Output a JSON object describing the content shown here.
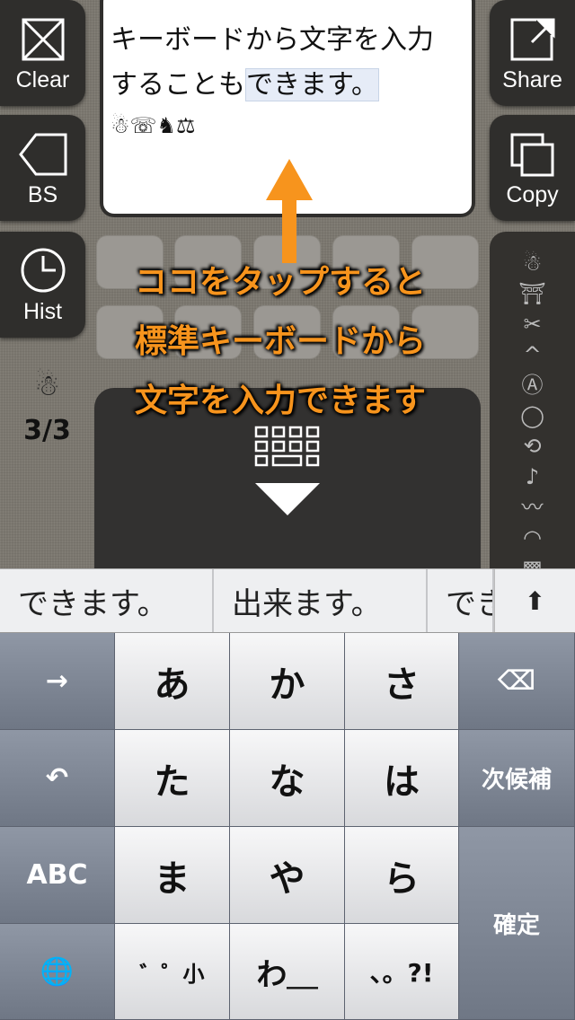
{
  "left_buttons": [
    {
      "label": "Clear",
      "icon": "x-box-icon"
    },
    {
      "label": "BS",
      "icon": "backspace-icon"
    },
    {
      "label": "Hist",
      "icon": "clock-icon"
    }
  ],
  "right_buttons": [
    {
      "label": "Share",
      "icon": "share-icon"
    },
    {
      "label": "Copy",
      "icon": "copy-icon"
    }
  ],
  "textbox": {
    "line1": "キーボードから文字を入力",
    "line2_plain": "することも",
    "line2_marked": "できます。",
    "emoji_line": "☃☏♞⚖"
  },
  "history": {
    "icon": "☃",
    "count": "3/3"
  },
  "overlay": {
    "lines": [
      "ココをタップすると",
      "標準キーボードから",
      "文字を入力できます"
    ],
    "color": "#f7941d"
  },
  "right_panel": {
    "symbols": [
      "☃",
      "⛩",
      "✂",
      "^",
      "Ⓐ",
      "◯",
      "⟲",
      "♪",
      "〰",
      "◠",
      "▩",
      "◓"
    ]
  },
  "candidates": [
    "できます。",
    "出来ます。",
    "できる"
  ],
  "keyboard": {
    "rows": [
      [
        "→",
        "あ",
        "か",
        "さ",
        "⌫"
      ],
      [
        "↶",
        "た",
        "な",
        "は",
        "次候補"
      ],
      [
        "ABC",
        "ま",
        "や",
        "ら",
        "確定"
      ],
      [
        "🌐",
        "゛゜小",
        "わ＿",
        "、。?!"
      ]
    ]
  }
}
